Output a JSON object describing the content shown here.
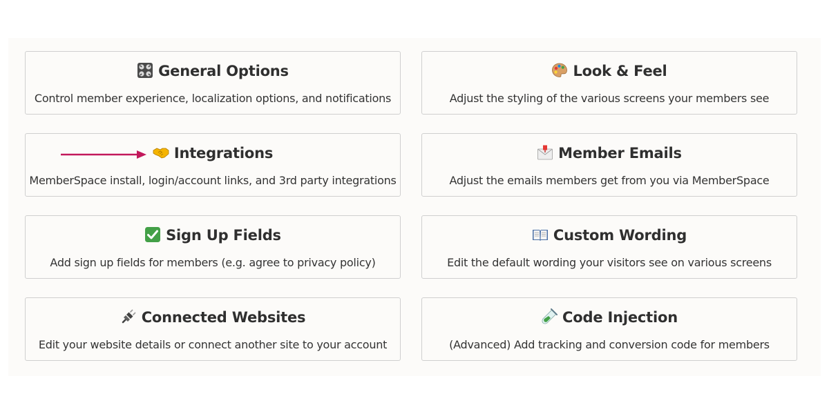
{
  "cards": [
    {
      "icon": "control-knobs-icon",
      "title": "General Options",
      "desc": "Control member experience, localization options, and notifications"
    },
    {
      "icon": "artist-palette-icon",
      "title": "Look & Feel",
      "desc": "Adjust the styling of the various screens your members see"
    },
    {
      "icon": "handshake-icon",
      "title": "Integrations",
      "desc": "MemberSpace install, login/account links, and 3rd party integrations"
    },
    {
      "icon": "envelope-icon",
      "title": "Member Emails",
      "desc": "Adjust the emails members get from you via MemberSpace"
    },
    {
      "icon": "check-mark-icon",
      "title": "Sign Up Fields",
      "desc": "Add sign up fields for members (e.g. agree to privacy policy)"
    },
    {
      "icon": "open-book-icon",
      "title": "Custom Wording",
      "desc": "Edit the default wording your visitors see on various screens"
    },
    {
      "icon": "plug-icon",
      "title": "Connected Websites",
      "desc": "Edit your website details or connect another site to your account"
    },
    {
      "icon": "test-tube-icon",
      "title": "Code Injection",
      "desc": "(Advanced) Add tracking and conversion code for members"
    }
  ],
  "colors": {
    "arrow": "#c2185b",
    "border": "#cfcfcf",
    "panel_bg": "#fcfbf9",
    "title_text": "#2f2f2f"
  }
}
